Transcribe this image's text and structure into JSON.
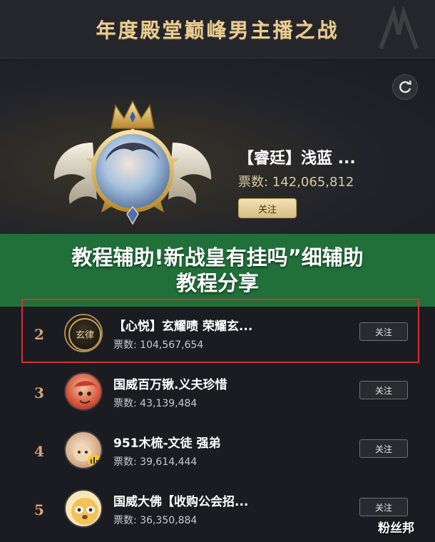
{
  "header": {
    "title": "年度殿堂巅峰男主播之战"
  },
  "champion": {
    "name": "【睿廷】浅蓝 ...",
    "votes_label": "票数: ",
    "votes": "142,065,812",
    "follow_label": "关注"
  },
  "banner": {
    "line1": "教程辅助!新战皇有挂吗”细辅助",
    "line2": "教程分享"
  },
  "list": {
    "items": [
      {
        "rank": "2",
        "name": "【心悦】玄耀啧 荣耀玄...",
        "votes_label": "票数: ",
        "votes": "104,567,654",
        "follow_label": "关注",
        "avatar_text": "玄律"
      },
      {
        "rank": "3",
        "name": "国威百万锹.义夫珍惜",
        "votes_label": "票数: ",
        "votes": "43,139,484",
        "follow_label": "关注"
      },
      {
        "rank": "4",
        "name": "951木梳-文徒 强弟",
        "votes_label": "票数: ",
        "votes": "39,614,444",
        "follow_label": "关注"
      },
      {
        "rank": "5",
        "name": "国威大佛【收购公会招...",
        "votes_label": "票数: ",
        "votes": "36,350,884",
        "follow_label": "关注"
      }
    ]
  },
  "watermark": "粉丝邦",
  "colors": {
    "accent_gold": "#e9cd93",
    "banner_green": "#21703a",
    "highlight_red": "#d5302f",
    "rank_color": "#d5a27a"
  }
}
